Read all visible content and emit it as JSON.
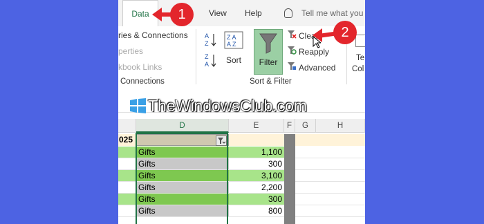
{
  "tabs": {
    "data": "Data",
    "view": "View",
    "help": "Help",
    "tell_me": "Tell me what you"
  },
  "queries_group": {
    "queries_connections": "ries & Connections",
    "properties": "perties",
    "edit_links": "kbook Links",
    "label": "Connections"
  },
  "sort_filter_group": {
    "sort_label": "Sort",
    "filter_label": "Filter",
    "clear_label": "Clear",
    "reapply_label": "Reapply",
    "advanced_label": "Advanced",
    "label": "Sort & Filter"
  },
  "next_group": {
    "line1": "Te",
    "line2": "Col"
  },
  "watermark": "TheWindowsClub.com",
  "columns": [
    "D",
    "E",
    "F",
    "G",
    "H"
  ],
  "header_row": {
    "left_value": "025"
  },
  "rows": [
    {
      "d": "Gifts",
      "e": "1,100"
    },
    {
      "d": "Gifts",
      "e": "300"
    },
    {
      "d": "Gifts",
      "e": "3,100"
    },
    {
      "d": "Gifts",
      "e": "2,200"
    },
    {
      "d": "Gifts",
      "e": "300"
    },
    {
      "d": "Gifts",
      "e": "800"
    }
  ],
  "callouts": [
    "1",
    "2"
  ],
  "colors": {
    "background": "#4d63e3",
    "excel_green": "#217346",
    "callout_red": "#e3262c",
    "row_green": "#7ec850",
    "row_gray": "#c8c8c8"
  }
}
